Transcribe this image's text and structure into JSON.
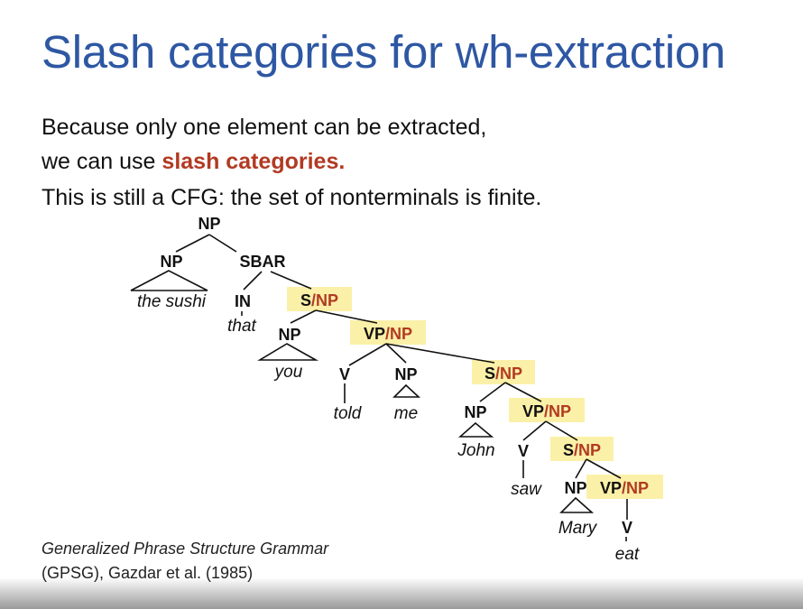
{
  "slide": {
    "title": "Slash categories for wh-extraction",
    "line1": "Because only one element can be extracted,",
    "line2_prefix": "we can use ",
    "line2_emphasis": "slash categories.",
    "line3": "This is still a CFG: the set of nonterminals is finite.",
    "citation_line1": "Generalized Phrase Structure Grammar",
    "citation_line2": "(GPSG), Gazdar et al. (1985)",
    "emphasis_color": "#b23a22",
    "title_color": "#2e57a3",
    "highlight_color": "#fbf0a8"
  },
  "tree": {
    "labels": {
      "np_root": "NP",
      "np_the_sushi": "NP",
      "sbar": "SBAR",
      "in": "IN",
      "np_you": "NP",
      "v_told": "V",
      "np_me": "NP",
      "np_john": "NP",
      "v_saw": "V",
      "np_mary": "NP",
      "v_eat": "V"
    },
    "slash_labels": {
      "s_np_1": {
        "cat": "S",
        "gap": "NP"
      },
      "vp_np_1": {
        "cat": "VP",
        "gap": "NP"
      },
      "s_np_2": {
        "cat": "S",
        "gap": "NP"
      },
      "vp_np_2": {
        "cat": "VP",
        "gap": "NP"
      },
      "s_np_3": {
        "cat": "S",
        "gap": "NP"
      },
      "vp_np_3": {
        "cat": "VP",
        "gap": "NP"
      }
    },
    "words": {
      "the_sushi": "the sushi",
      "that": "that",
      "you": "you",
      "told": "told",
      "me": "me",
      "john": "John",
      "saw": "saw",
      "mary": "Mary",
      "eat": "eat"
    }
  }
}
